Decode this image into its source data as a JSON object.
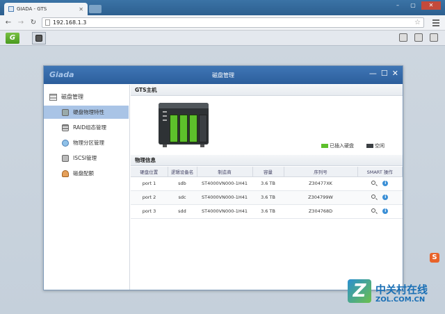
{
  "browser": {
    "tab_title": "GIADA - GTS",
    "url": "192.168.1.3",
    "bookmark_g_label": "G"
  },
  "dialog": {
    "logo": "Giada",
    "title": "磁盘管理"
  },
  "sidebar": {
    "header": "磁盘管理",
    "items": [
      {
        "label": "硬盘物理特性",
        "active": true
      },
      {
        "label": "RAID组态管理",
        "active": false
      },
      {
        "label": "物理分区管理",
        "active": false
      },
      {
        "label": "ISCSI管理",
        "active": false
      },
      {
        "label": "磁盘配额",
        "active": false
      }
    ]
  },
  "host_section": {
    "title": "GTS主机",
    "legend": [
      {
        "label": "已插入硬盘",
        "color": "#5dc02b"
      },
      {
        "label": "空闲",
        "color": "#3b3f43"
      }
    ]
  },
  "physical_info": {
    "title": "物理信息",
    "columns": [
      "硬盘位置",
      "逻辑设备名",
      "制造商",
      "容量",
      "序列号",
      "SMART 操作"
    ],
    "rows": [
      {
        "port": "port 1",
        "device": "sdb",
        "maker": "ST4000VN000-1H41",
        "capacity": "3.6 TB",
        "serial": "Z30477XK"
      },
      {
        "port": "port 2",
        "device": "sdc",
        "maker": "ST4000VN000-1H41",
        "capacity": "3.6 TB",
        "serial": "Z304799W"
      },
      {
        "port": "port 3",
        "device": "sdd",
        "maker": "ST4000VN000-1H41",
        "capacity": "3.6 TB",
        "serial": "Z304768D"
      }
    ]
  },
  "watermark": {
    "cn": "中关村在线",
    "en": "ZOL.COM.CN",
    "z": "Z",
    "sogou": "S"
  }
}
